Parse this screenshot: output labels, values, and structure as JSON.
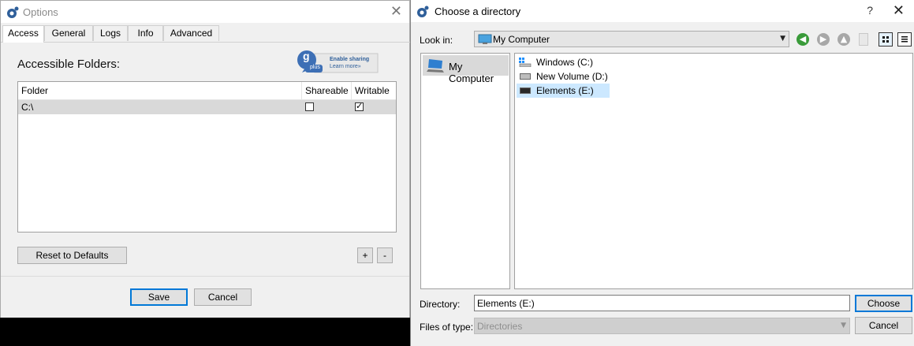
{
  "options_dialog": {
    "title": "Options",
    "tabs": [
      {
        "label": "Access"
      },
      {
        "label": "General"
      },
      {
        "label": "Logs"
      },
      {
        "label": "Info"
      },
      {
        "label": "Advanced"
      }
    ],
    "heading": "Accessible Folders:",
    "gplus_badge": {
      "logo_letter": "g",
      "logo_sub": "plus",
      "line1": "Enable sharing",
      "line2": "Learn more»"
    },
    "table": {
      "columns": [
        "Folder",
        "Shareable",
        "Writable"
      ],
      "rows": [
        {
          "folder": "C:\\",
          "shareable": false,
          "writable": true
        }
      ]
    },
    "reset_label": "Reset to Defaults",
    "add_label": "+",
    "remove_label": "-",
    "save_label": "Save",
    "cancel_label": "Cancel"
  },
  "directory_dialog": {
    "title": "Choose a directory",
    "help_label": "?",
    "look_in_label": "Look in:",
    "look_in_value": "My Computer",
    "sidebar": [
      {
        "label": "My Computer"
      }
    ],
    "files": [
      {
        "name": "Windows (C:)",
        "icon": "windows-drive-icon"
      },
      {
        "name": "New Volume (D:)",
        "icon": "drive-icon"
      },
      {
        "name": "Elements (E:)",
        "icon": "drive-icon",
        "selected": true
      }
    ],
    "directory_label": "Directory:",
    "directory_value": "Elements (E:)",
    "file_type_label": "Files of type:",
    "file_type_value": "Directories",
    "choose_label": "Choose",
    "cancel_label": "Cancel"
  },
  "colors": {
    "selection": "#cce8ff",
    "default_button_border": "#0078d7",
    "back_arrow": "#3a9b3a"
  }
}
